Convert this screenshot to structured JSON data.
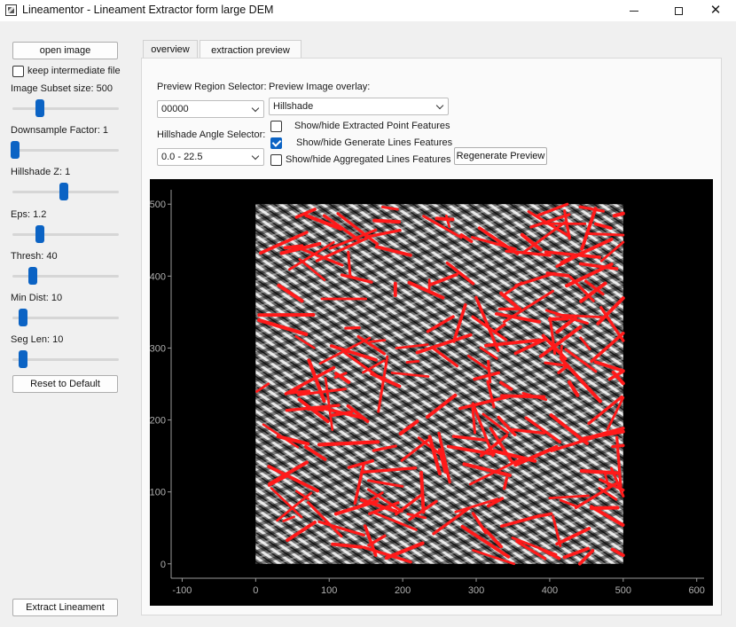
{
  "window": {
    "title": "Lineamentor - Lineament Extractor form large DEM"
  },
  "sidebar": {
    "open_image_label": "open image",
    "keep_intermediate_label": "keep intermediate file",
    "keep_intermediate_checked": false,
    "sliders": [
      {
        "label": "Image Subset size: 500",
        "level": 0.25
      },
      {
        "label": "Downsample Factor: 1",
        "level": 0.0
      },
      {
        "label": "Hillshade Z: 1",
        "level": 0.5
      },
      {
        "label": "Eps: 1.2",
        "level": 0.25
      },
      {
        "label": "Thresh: 40",
        "level": 0.18
      },
      {
        "label": "Min Dist: 10",
        "level": 0.08
      },
      {
        "label": "Seg Len: 10",
        "level": 0.08
      }
    ],
    "reset_label": "Reset to Default",
    "extract_label": "Extract Lineament"
  },
  "tabs": [
    {
      "label": "overview",
      "active": false
    },
    {
      "label": "extraction preview",
      "active": true
    }
  ],
  "controls": {
    "region_selector_label": "Preview Region Selector:",
    "region_value": "00000",
    "angle_selector_label": "Hillshade Angle Selector:",
    "angle_value": "0.0 - 22.5",
    "overlay_label": "Preview Image overlay:",
    "overlay_value": "Hillshade",
    "show_points_label": "Show/hide Extracted Point Features",
    "show_points_checked": false,
    "show_lines_label": "Show/hide Generate Lines Features",
    "show_lines_checked": true,
    "show_aggregated_label": "Show/hide Aggregated Lines Features",
    "show_aggregated_checked": false,
    "regenerate_label": "Regenerate Preview"
  },
  "plot": {
    "x_ticks": [
      "-100",
      "0",
      "100",
      "200",
      "300",
      "400",
      "500",
      "600"
    ],
    "y_ticks": [
      "0",
      "100",
      "200",
      "300",
      "400",
      "500"
    ],
    "xlim": [
      -115,
      610
    ],
    "ylim": [
      -20,
      520
    ],
    "image_extent": [
      0,
      500,
      0,
      500
    ],
    "line_color": "#ff1a1a"
  }
}
